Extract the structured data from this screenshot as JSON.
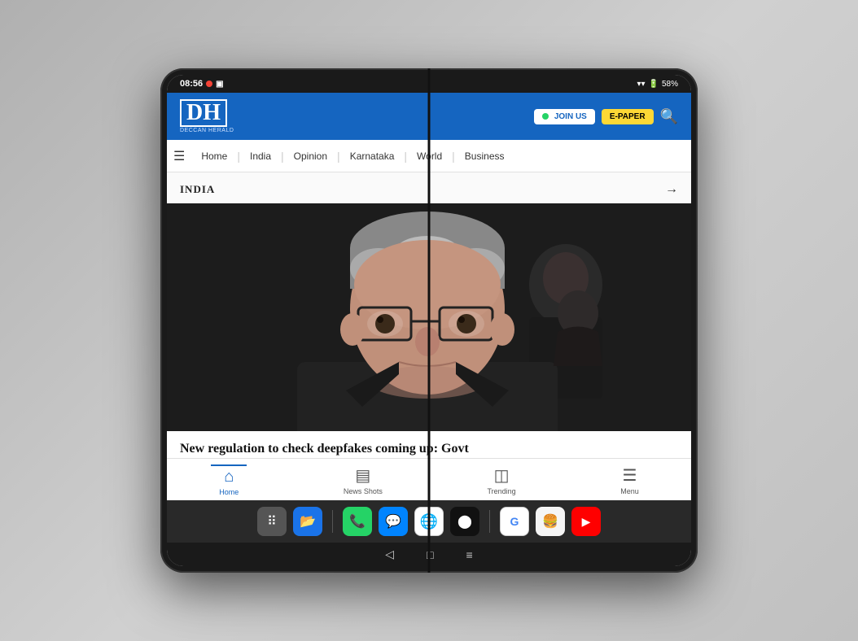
{
  "scene": {
    "background": "#c8c8c8"
  },
  "status_bar": {
    "time": "08:56",
    "battery": "58%",
    "wifi_icon": "wifi",
    "battery_icon": "battery"
  },
  "header": {
    "logo": "DH",
    "logo_subtitle": "DECCAN HERALD",
    "join_us_label": "JOIN US",
    "epaper_label": "E-PAPER",
    "search_icon": "search"
  },
  "navbar": {
    "menu_icon": "≡",
    "items": [
      {
        "label": "Home",
        "active": false
      },
      {
        "label": "India",
        "active": false
      },
      {
        "label": "Opinion",
        "active": false
      },
      {
        "label": "Karnataka",
        "active": false
      },
      {
        "label": "World",
        "active": false
      },
      {
        "label": "Business",
        "active": false
      }
    ]
  },
  "content": {
    "section_label": "INDIA",
    "section_arrow": "→",
    "headline": "New regulation to check deepfakes coming up: Govt"
  },
  "bottom_nav": {
    "items": [
      {
        "icon": "⌂",
        "label": "Home",
        "active": true
      },
      {
        "icon": "▤",
        "label": "News Shots",
        "active": false
      },
      {
        "icon": "▣",
        "label": "Trending",
        "active": false
      },
      {
        "icon": "≡",
        "label": "Menu",
        "active": false
      }
    ]
  },
  "android_nav": {
    "back": "◁",
    "home": "□",
    "recents": "≡"
  },
  "app_dock": {
    "apps": [
      {
        "name": "apps-icon",
        "color": "#555",
        "symbol": "⠿"
      },
      {
        "name": "files-icon",
        "color": "#4285F4",
        "symbol": "📁"
      },
      {
        "name": "phone-icon",
        "color": "#25d366",
        "symbol": "📞"
      },
      {
        "name": "messenger-icon",
        "color": "#0084ff",
        "symbol": "💬"
      },
      {
        "name": "chrome-icon",
        "color": "#EA4335",
        "symbol": ""
      },
      {
        "name": "camera-icon",
        "color": "#333",
        "symbol": "●"
      },
      {
        "name": "google-icon",
        "color": "#4285F4",
        "symbol": "G"
      },
      {
        "name": "food-icon",
        "color": "#ff6600",
        "symbol": "🍔"
      },
      {
        "name": "youtube-icon",
        "color": "#FF0000",
        "symbol": "▶"
      }
    ]
  }
}
